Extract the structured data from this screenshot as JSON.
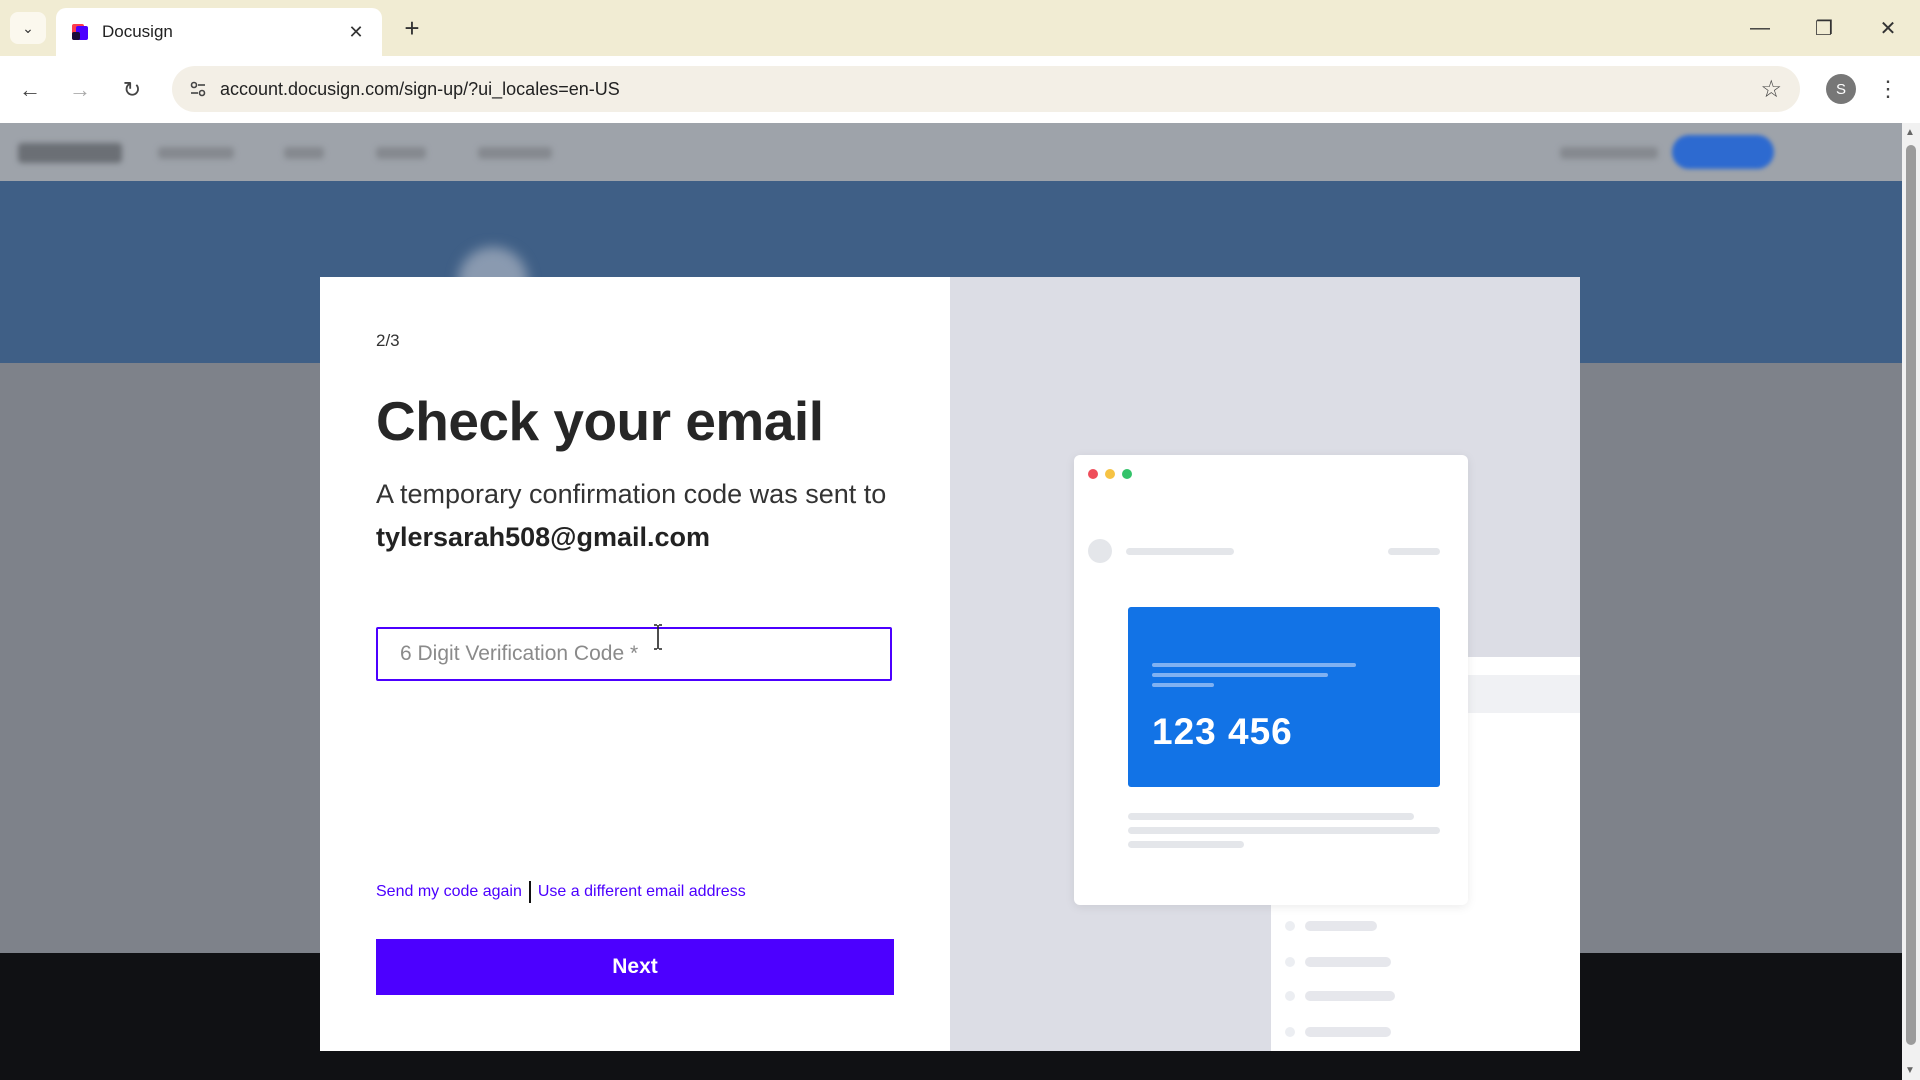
{
  "browser": {
    "tab_title": "Docusign",
    "url": "account.docusign.com/sign-up/?ui_locales=en-US",
    "profile_initial": "S"
  },
  "modal": {
    "step": "2/3",
    "heading": "Check your email",
    "desc_prefix": "A temporary confirmation code was sent to ",
    "email": "tylersarah508@gmail.com",
    "code_placeholder": "6 Digit Verification Code *",
    "resend_label": "Send my code again",
    "different_email_label": "Use a different email address",
    "next_label": "Next",
    "accent_color": "#4c00ff"
  },
  "illustration": {
    "sample_code": "123 456",
    "card_color": "#1273e6"
  }
}
